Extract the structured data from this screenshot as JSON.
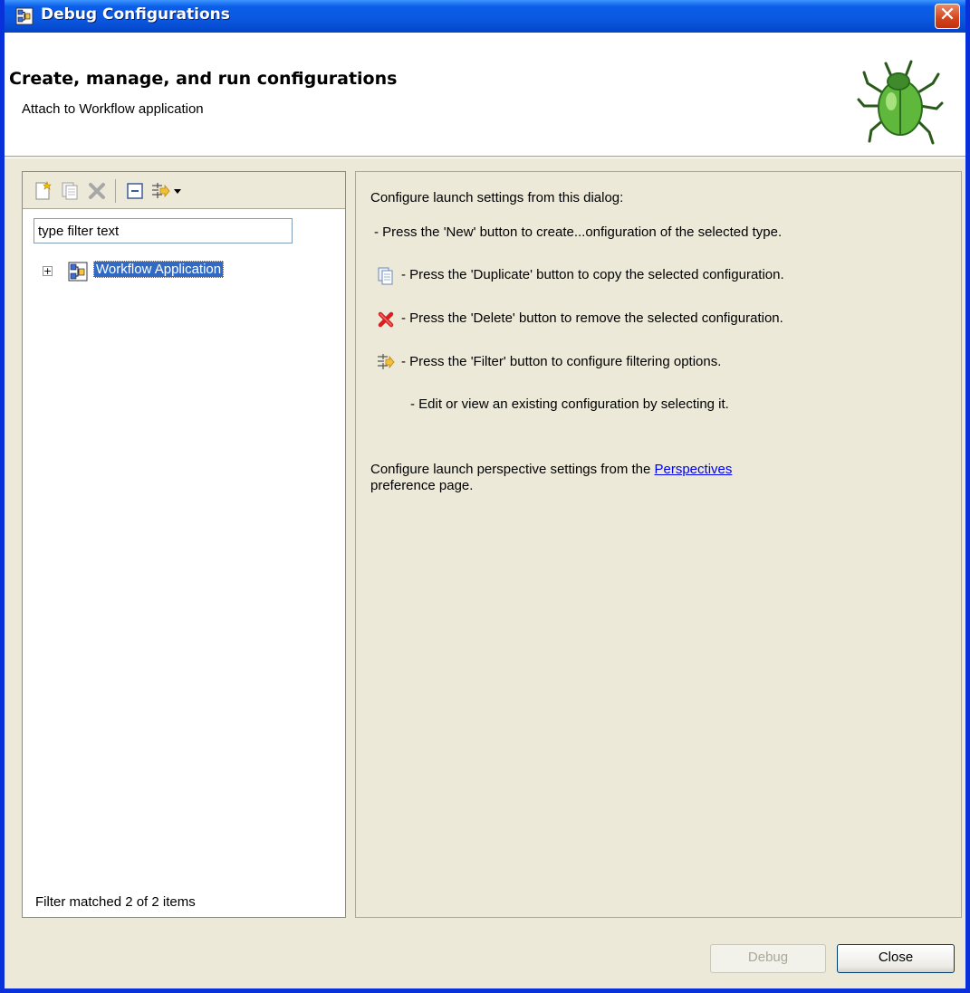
{
  "window": {
    "title": "Debug Configurations",
    "close_glyph": "✕"
  },
  "header": {
    "title": "Create, manage, and run configurations",
    "subtitle": "Attach to Workflow application",
    "banner_icon": "bug-icon"
  },
  "left_panel": {
    "toolbar": [
      "new-config-icon",
      "duplicate-icon",
      "delete-icon",
      "collapse-all-icon",
      "filter-icon",
      "dropdown-arrow-icon"
    ],
    "filter": {
      "value": "type filter text"
    },
    "tree": [
      {
        "label": "Workflow Application",
        "expander": "+",
        "selected": true
      }
    ],
    "status": "Filter matched 2 of 2 items"
  },
  "right_panel": {
    "intro": "Configure launch settings from this dialog:",
    "lines": [
      "- Press the 'New' button to create...onfiguration of the selected type.",
      "- Press the 'Duplicate' button to copy the selected configuration.",
      "- Press the 'Delete' button to remove the selected configuration.",
      "- Press the 'Filter' button to configure filtering options.",
      "- Edit or view an existing configuration by selecting it."
    ],
    "perspective_text": "Configure launch perspective settings from the ",
    "perspective_link": "Perspectives",
    "perspective_text2": "preference page."
  },
  "buttons": {
    "debug": "Debug",
    "close": "Close"
  },
  "colors": {
    "title_bar": "#0a5ee8",
    "selection": "#316ac5",
    "dialog_bg": "#ece9d8",
    "link": "#0000ee"
  }
}
